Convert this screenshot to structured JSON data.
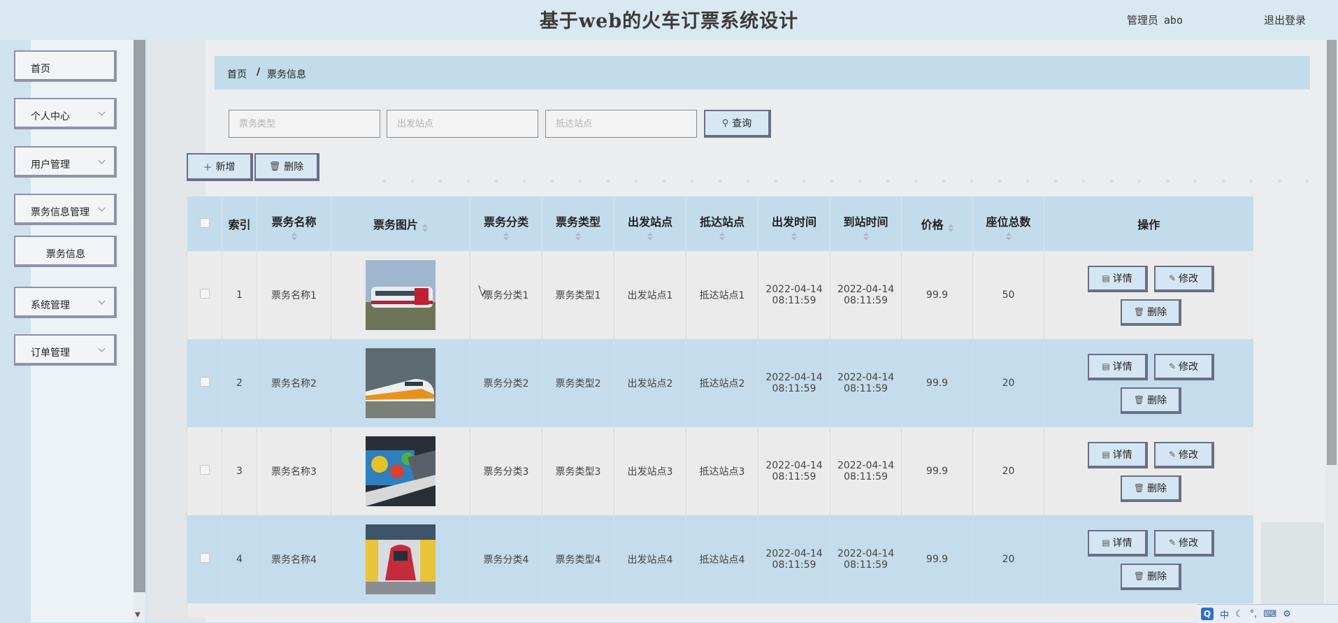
{
  "header": {
    "title": "基于web的火车订票系统设计",
    "admin_label": "管理员",
    "admin_name": "abo",
    "logout": "退出登录"
  },
  "sidebar": {
    "items": [
      {
        "label": "首页",
        "has_arrow": false
      },
      {
        "label": "个人中心",
        "has_arrow": true
      },
      {
        "label": "用户管理",
        "has_arrow": true
      },
      {
        "label": "票务信息管理",
        "has_arrow": true
      },
      {
        "label": "票务信息",
        "has_arrow": false
      },
      {
        "label": "系统管理",
        "has_arrow": true
      },
      {
        "label": "订单管理",
        "has_arrow": true
      }
    ]
  },
  "breadcrumb": {
    "home": "首页",
    "separator": "/",
    "current": "票务信息"
  },
  "search": {
    "type_placeholder": "票务类型",
    "from_placeholder": "出发站点",
    "to_placeholder": "抵达站点",
    "button": "查询",
    "button_icon": "search-icon"
  },
  "toolbar": {
    "add": "新增",
    "add_icon": "plus-icon",
    "delete": "删除",
    "delete_icon": "trash-icon"
  },
  "table": {
    "headers": [
      "索引",
      "票务名称",
      "票务图片",
      "票务分类",
      "票务类型",
      "出发站点",
      "抵达站点",
      "出发时间",
      "到站时间",
      "价格",
      "座位总数",
      "操作"
    ],
    "rows": [
      {
        "index": "1",
        "name": "票务名称1",
        "image": "train-photo-red-white",
        "category": "票务分类1",
        "type": "票务类型1",
        "from": "出发站点1",
        "to": "抵达站点1",
        "depart": "2022-04-14 08:11:59",
        "arrive": "2022-04-14 08:11:59",
        "price": "99.9",
        "seats": "50"
      },
      {
        "index": "2",
        "name": "票务名称2",
        "image": "train-photo-high-speed",
        "category": "票务分类2",
        "type": "票务类型2",
        "from": "出发站点2",
        "to": "抵达站点2",
        "depart": "2022-04-14 08:11:59",
        "arrive": "2022-04-14 08:11:59",
        "price": "99.9",
        "seats": "20"
      },
      {
        "index": "3",
        "name": "票务名称3",
        "image": "train-photo-graffiti",
        "category": "票务分类3",
        "type": "票务类型3",
        "from": "出发站点3",
        "to": "抵达站点3",
        "depart": "2022-04-14 08:11:59",
        "arrive": "2022-04-14 08:11:59",
        "price": "99.9",
        "seats": "20"
      },
      {
        "index": "4",
        "name": "票务名称4",
        "image": "train-photo-station",
        "category": "票务分类4",
        "type": "票务类型4",
        "from": "出发站点4",
        "to": "抵达站点4",
        "depart": "2022-04-14 08:11:59",
        "arrive": "2022-04-14 08:11:59",
        "price": "99.9",
        "seats": "20"
      }
    ],
    "actions": {
      "detail": "详情",
      "edit": "修改",
      "delete": "删除"
    }
  },
  "ime": {
    "mode": "中"
  },
  "colors": {
    "header_bg": "#c3dcec",
    "even_row": "#c5dcec",
    "odd_row": "#ebebeb",
    "button_border": "#6a6f86"
  }
}
